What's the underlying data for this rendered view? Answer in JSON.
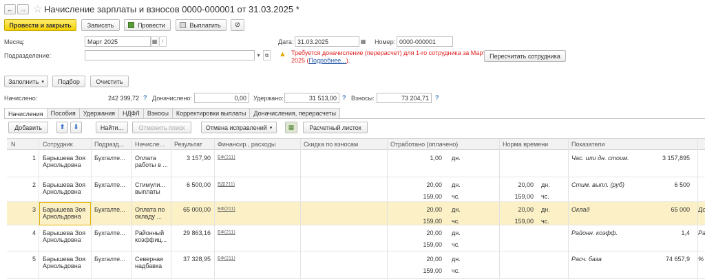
{
  "window": {
    "title": "Начисление зарплаты и взносов 0000-000001 от 31.03.2025 *",
    "nav_back": "←",
    "nav_forward": "→",
    "star": "☆"
  },
  "toolbar": {
    "post_close": "Провести и закрыть",
    "save": "Записать",
    "post": "Провести",
    "pay": "Выплатить"
  },
  "header": {
    "month_label": "Месяц:",
    "month_value": "Март 2025",
    "date_label": "Дата:",
    "date_value": "31.03.2025",
    "number_label": "Номер:",
    "number_value": "0000-000001",
    "division_label": "Подразделение:",
    "division_value": "",
    "warning_text": "Требуется доначисление (перерасчет) для 1-го сотрудника за Март",
    "warning_text2": "2025 (",
    "warning_link": "Подробнее...",
    "warning_text3": ").",
    "recalc_button": "Пересчитать сотрудника"
  },
  "actions": {
    "fill": "Заполнить",
    "select": "Подбор",
    "clear": "Очистить"
  },
  "totals": {
    "accrued_label": "Начислено:",
    "accrued_value": "242 399,72",
    "additional_label": "Доначислено:",
    "additional_value": "0,00",
    "withheld_label": "Удержано:",
    "withheld_value": "31 513,00",
    "contrib_label": "Взносы:",
    "contrib_value": "73 204,71",
    "q": "?"
  },
  "tabs": [
    "Начисления",
    "Пособия",
    "Удержания",
    "НДФЛ",
    "Взносы",
    "Корректировки выплаты",
    "Доначисления, перерасчеты"
  ],
  "grid_toolbar": {
    "add": "Добавить",
    "find": "Найти...",
    "cancel_search": "Отменить поиск",
    "cancel_fix": "Отмена исправлений",
    "payslip": "Расчетный листок"
  },
  "columns": {
    "n": "N",
    "employee": "Сотрудник",
    "division": "Подразд...",
    "accrual": "Начисле...",
    "result": "Результат",
    "finance": "Финансир., расходы",
    "discount": "Скидка по взносам",
    "worked": "Отработано (оплачено)",
    "norm": "Норма времени",
    "indicators": "Показатели"
  },
  "rows": [
    {
      "n": "1",
      "emp1": "Барышева Зоя",
      "emp2": "Арнольдовна",
      "div": "Бухгалте...",
      "acc1": "Оплата",
      "acc2": "работы в ...",
      "result": "3 157,90",
      "fin": "БФ(211)",
      "w1": "1,00",
      "w1u": "дн.",
      "w2": "",
      "w2u": "",
      "n1": "",
      "n1u": "",
      "n2": "",
      "n2u": "",
      "ind": "Час. или дн. стоим.",
      "indv": "3 157,895",
      "indx": ""
    },
    {
      "n": "2",
      "emp1": "Барышева Зоя",
      "emp2": "Арнольдовна",
      "div": "Бухгалте...",
      "acc1": "Стимули...",
      "acc2": "выплаты",
      "result": "6 500,00",
      "fin": "ВД(211)",
      "w1": "20,00",
      "w1u": "дн.",
      "w2": "159,00",
      "w2u": "чс.",
      "n1": "20,00",
      "n1u": "дн.",
      "n2": "159,00",
      "n2u": "чс.",
      "ind": "Стим. выпл. (руб)",
      "indv": "6 500",
      "indx": ""
    },
    {
      "n": "3",
      "emp1": "Барышева Зоя",
      "emp2": "Арнольдовна",
      "div": "Бухгалте...",
      "acc1": "Оплата по",
      "acc2": "окладу ...",
      "result": "65 000,00",
      "fin": "БФ(211)",
      "w1": "20,00",
      "w1u": "дн.",
      "w2": "159,00",
      "w2u": "чс.",
      "n1": "20,00",
      "n1u": "дн.",
      "n2": "159,00",
      "n2u": "чс.",
      "ind": "Оклад",
      "indv": "65 000",
      "indx": "До"
    },
    {
      "n": "4",
      "emp1": "Барышева Зоя",
      "emp2": "Арнольдовна",
      "div": "Бухгалте...",
      "acc1": "Районный",
      "acc2": "коэффиц...",
      "result": "29 863,16",
      "fin": "БФ(211)",
      "w1": "20,00",
      "w1u": "дн.",
      "w2": "159,00",
      "w2u": "чс.",
      "n1": "",
      "n1u": "",
      "n2": "",
      "n2u": "",
      "ind": "Районн. коэфф.",
      "indv": "1,4",
      "indx": "Ра"
    },
    {
      "n": "5",
      "emp1": "Барышева Зоя",
      "emp2": "Арнольдовна",
      "div": "Бухгалте...",
      "acc1": "Северная",
      "acc2": "надбавка",
      "result": "37 328,95",
      "fin": "БФ(211)",
      "w1": "20,00",
      "w1u": "дн.",
      "w2": "159,00",
      "w2u": "чс.",
      "n1": "",
      "n1u": "",
      "n2": "",
      "n2u": "",
      "ind": "Расч. база",
      "indv": "74 657,9",
      "indx": "%"
    }
  ]
}
